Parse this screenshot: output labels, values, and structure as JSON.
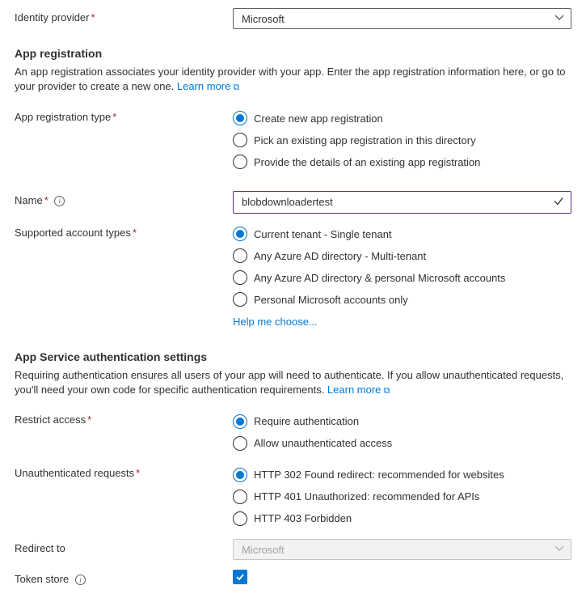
{
  "identity_provider": {
    "label": "Identity provider",
    "value": "Microsoft"
  },
  "app_registration": {
    "heading": "App registration",
    "description_pre": "An app registration associates your identity provider with your app. Enter the app registration information here, or go to your provider to create a new one. ",
    "learn_more": "Learn more",
    "type": {
      "label": "App registration type",
      "options": [
        "Create new app registration",
        "Pick an existing app registration in this directory",
        "Provide the details of an existing app registration"
      ]
    },
    "name": {
      "label": "Name",
      "value": "blobdownloadertest"
    },
    "supported_account_types": {
      "label": "Supported account types",
      "options": [
        "Current tenant - Single tenant",
        "Any Azure AD directory - Multi-tenant",
        "Any Azure AD directory & personal Microsoft accounts",
        "Personal Microsoft accounts only"
      ],
      "help_link": "Help me choose..."
    }
  },
  "app_service_auth": {
    "heading": "App Service authentication settings",
    "description_pre": "Requiring authentication ensures all users of your app will need to authenticate. If you allow unauthenticated requests, you'll need your own code for specific authentication requirements. ",
    "learn_more": "Learn more",
    "restrict_access": {
      "label": "Restrict access",
      "options": [
        "Require authentication",
        "Allow unauthenticated access"
      ]
    },
    "unauthenticated_requests": {
      "label": "Unauthenticated requests",
      "options": [
        "HTTP 302 Found redirect: recommended for websites",
        "HTTP 401 Unauthorized: recommended for APIs",
        "HTTP 403 Forbidden"
      ]
    },
    "redirect_to": {
      "label": "Redirect to",
      "value": "Microsoft"
    },
    "token_store": {
      "label": "Token store"
    }
  }
}
